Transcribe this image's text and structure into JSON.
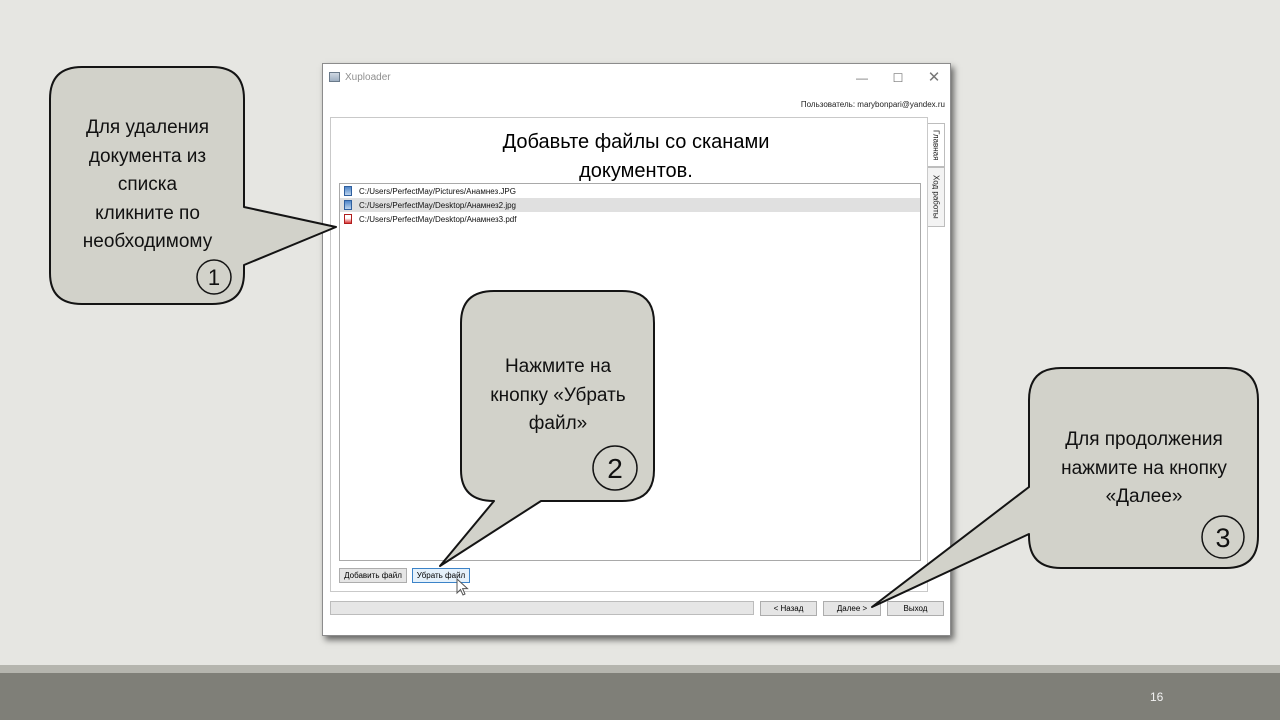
{
  "window": {
    "title": "Xuploader",
    "controls": {
      "minimize": "—",
      "maximize": "☐",
      "close": "✕"
    }
  },
  "user": {
    "label": "Пользователь:",
    "email": "marybonpari@yandex.ru"
  },
  "main": {
    "heading_line1": "Добавьте файлы со сканами",
    "heading_line2": "документов."
  },
  "tabs": [
    {
      "label": "Главная",
      "active": true
    },
    {
      "label": "Ход работы",
      "active": false
    }
  ],
  "files": [
    {
      "path": "C:/Users/PerfectMay/Pictures/Анамнез.JPG",
      "icon": "image-file-icon",
      "selected": false
    },
    {
      "path": "C:/Users/PerfectMay/Desktop/Анамнез2.jpg",
      "icon": "image-file-icon",
      "selected": true
    },
    {
      "path": "C:/Users/PerfectMay/Desktop/Анамнез3.pdf",
      "icon": "pdf-file-icon",
      "selected": false
    }
  ],
  "buttons": {
    "add": "Добавить файл",
    "remove": "Убрать файл",
    "back": "< Назад",
    "next": "Далее >",
    "exit": "Выход"
  },
  "progress": {
    "value": 0
  },
  "callouts": [
    {
      "lines": [
        "Для удаления",
        "документа из",
        "списка",
        "кликните по",
        "необходимому"
      ],
      "number": "1"
    },
    {
      "lines": [
        "Нажмите на",
        "кнопку «Убрать",
        "файл»"
      ],
      "number": "2"
    },
    {
      "lines": [
        "Для продолжения",
        "нажмите на кнопку",
        "«Далее»"
      ],
      "number": "3"
    }
  ],
  "slide": {
    "page_number": "16"
  },
  "colors": {
    "slide_background": "#e6e6e2",
    "callout_fill": "#d2d2ca",
    "footer": "#7f7f78",
    "selected_row": "#e0e0e0",
    "active_button_border": "#3c83c8"
  }
}
